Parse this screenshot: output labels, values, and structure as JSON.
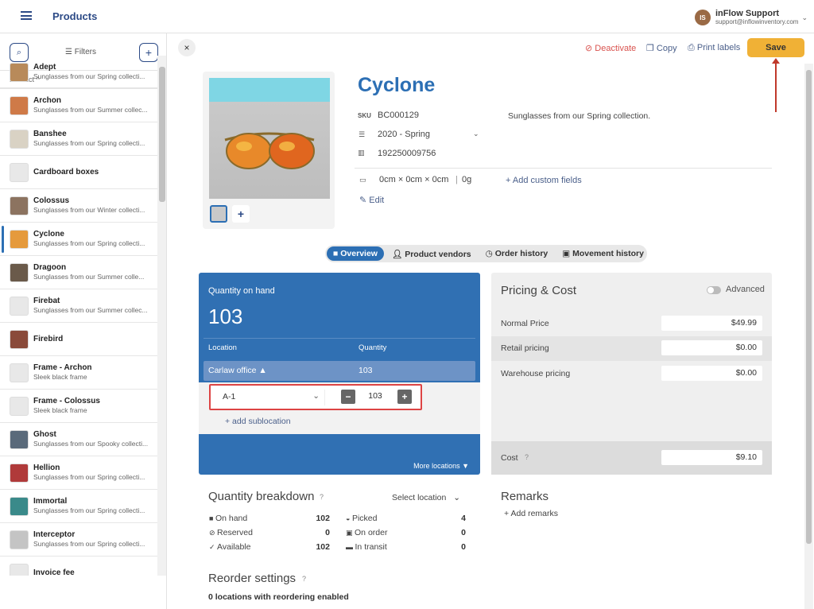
{
  "header": {
    "title": "Products",
    "user_name": "inFlow Support",
    "user_email": "support@inflowinventory.com",
    "avatar_initials": "IS"
  },
  "sidebar": {
    "filters_label": "Filters",
    "sort_label": "Product ^",
    "items": [
      {
        "name": "Adept",
        "desc": "Sunglasses from our Spring collecti..."
      },
      {
        "name": "Archon",
        "desc": "Sunglasses from our Summer collec..."
      },
      {
        "name": "Banshee",
        "desc": "Sunglasses from our Spring collecti..."
      },
      {
        "name": "Cardboard boxes",
        "desc": ""
      },
      {
        "name": "Colossus",
        "desc": "Sunglasses from our Winter collecti..."
      },
      {
        "name": "Cyclone",
        "desc": "Sunglasses from our Spring collecti..."
      },
      {
        "name": "Dragoon",
        "desc": "Sunglasses from our Summer colle..."
      },
      {
        "name": "Firebat",
        "desc": "Sunglasses from our Summer collec..."
      },
      {
        "name": "Firebird",
        "desc": ""
      },
      {
        "name": "Frame - Archon",
        "desc": "Sleek black frame"
      },
      {
        "name": "Frame - Colossus",
        "desc": "Sleek black frame"
      },
      {
        "name": "Ghost",
        "desc": "Sunglasses from our Spooky collecti..."
      },
      {
        "name": "Hellion",
        "desc": "Sunglasses from our Spring collecti..."
      },
      {
        "name": "Immortal",
        "desc": "Sunglasses from our Spring collecti..."
      },
      {
        "name": "Interceptor",
        "desc": "Sunglasses from our Spring collecti..."
      },
      {
        "name": "Invoice fee",
        "desc": ""
      }
    ]
  },
  "actions": {
    "deactivate": "Deactivate",
    "copy": "Copy",
    "print": "Print labels",
    "save": "Save"
  },
  "product": {
    "title": "Cyclone",
    "sku_label": "SKU",
    "sku": "BC000129",
    "category": "2020 - Spring",
    "barcode": "192250009756",
    "dimensions": "0cm × 0cm × 0cm",
    "weight": "0g",
    "description": "Sunglasses from our Spring collection.",
    "add_custom_fields": "Add custom fields",
    "edit": "Edit"
  },
  "tabs": [
    "Overview",
    "Product vendors",
    "Order history",
    "Movement history"
  ],
  "quantity": {
    "label": "Quantity on hand",
    "value": "103",
    "col_location": "Location",
    "col_quantity": "Quantity",
    "location": "Carlaw office ▲",
    "location_qty": "103",
    "sublocation": "A-1",
    "sublocation_qty": "103",
    "add_sublocation": "+ add sublocation",
    "more_locations": "More locations ▼"
  },
  "pricing": {
    "title": "Pricing & Cost",
    "advanced": "Advanced",
    "rows": [
      {
        "label": "Normal Price",
        "value": "$49.99"
      },
      {
        "label": "Retail pricing",
        "value": "$0.00"
      },
      {
        "label": "Warehouse pricing",
        "value": "$0.00"
      }
    ],
    "cost_label": "Cost",
    "cost_value": "$9.10"
  },
  "breakdown": {
    "title": "Quantity breakdown",
    "select_location": "Select location",
    "left": [
      {
        "label": "On hand",
        "value": "102"
      },
      {
        "label": "Reserved",
        "value": "0"
      },
      {
        "label": "Available",
        "value": "102"
      }
    ],
    "right": [
      {
        "label": "Picked",
        "value": "4"
      },
      {
        "label": "On order",
        "value": "0"
      },
      {
        "label": "In transit",
        "value": "0"
      }
    ]
  },
  "remarks": {
    "title": "Remarks",
    "add": "Add remarks"
  },
  "reorder": {
    "title": "Reorder settings",
    "summary": "0 locations with reordering enabled"
  },
  "colors": {
    "brand": "#2c6fb4",
    "save": "#f0b136",
    "danger": "#d9534f"
  }
}
